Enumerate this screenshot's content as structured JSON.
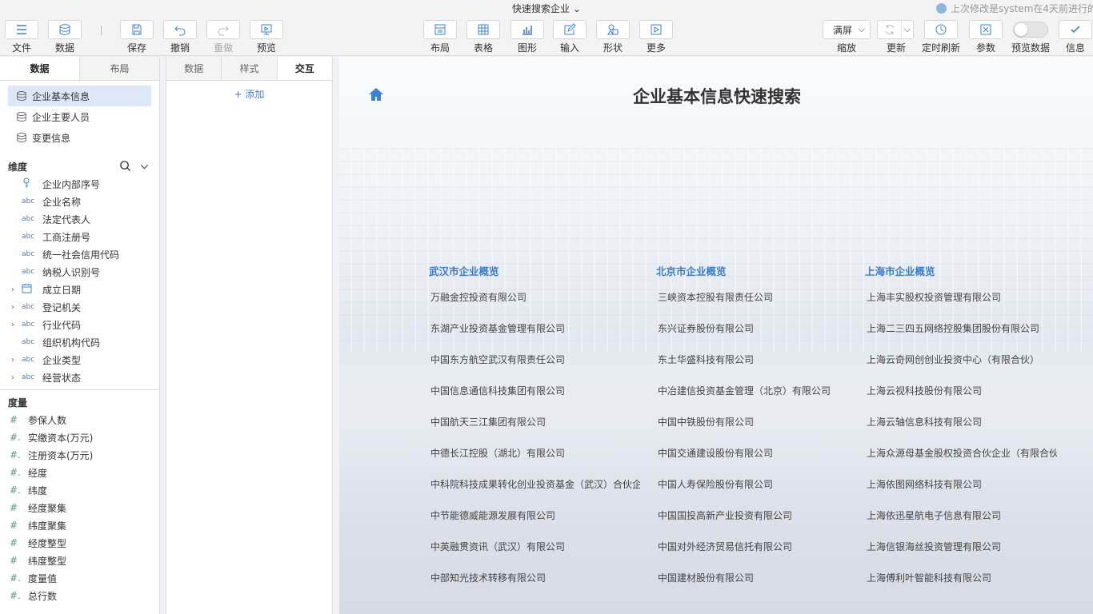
{
  "window": {
    "doc_title": "快速搜索企业",
    "last_modified": "上次修改是system在4天前进行的"
  },
  "toolbar": {
    "file": "文件",
    "data": "数据",
    "save": "保存",
    "undo": "撤销",
    "redo": "重做",
    "preview": "预览",
    "layout": "布局",
    "table": "表格",
    "chart": "图形",
    "input": "输入",
    "shape": "形状",
    "more": "更多",
    "zoom_value": "满屏",
    "zoom": "缩放",
    "refresh": "更新",
    "timed_refresh": "定时刷新",
    "params": "参数",
    "preview_data": "预览数据",
    "info": "信息"
  },
  "left_panel": {
    "tabs": [
      "数据",
      "布局"
    ],
    "datasets": [
      "企业基本信息",
      "企业主要人员",
      "变更信息"
    ],
    "dimensions_title": "维度",
    "dimensions": [
      {
        "label": "企业内部序号",
        "type": "key",
        "expandable": false
      },
      {
        "label": "企业名称",
        "type": "abc",
        "expandable": false
      },
      {
        "label": "法定代表人",
        "type": "abc",
        "expandable": false
      },
      {
        "label": "工商注册号",
        "type": "abc",
        "expandable": false
      },
      {
        "label": "统一社会信用代码",
        "type": "abc",
        "expandable": false
      },
      {
        "label": "纳税人识别号",
        "type": "abc",
        "expandable": false
      },
      {
        "label": "成立日期",
        "type": "date",
        "expandable": true
      },
      {
        "label": "登记机关",
        "type": "abc",
        "expandable": true
      },
      {
        "label": "行业代码",
        "type": "abc",
        "expandable": true
      },
      {
        "label": "组织机构代码",
        "type": "abc",
        "expandable": false
      },
      {
        "label": "企业类型",
        "type": "abc",
        "expandable": true
      },
      {
        "label": "经营状态",
        "type": "abc",
        "expandable": true
      }
    ],
    "measures_title": "度量",
    "measures": [
      {
        "label": "参保人数",
        "symbol": "#"
      },
      {
        "label": "实缴资本(万元)",
        "symbol": "#."
      },
      {
        "label": "注册资本(万元)",
        "symbol": "#."
      },
      {
        "label": "经度",
        "symbol": "#."
      },
      {
        "label": "纬度",
        "symbol": "#."
      },
      {
        "label": "经度聚集",
        "symbol": "#"
      },
      {
        "label": "纬度聚集",
        "symbol": "#"
      },
      {
        "label": "经度整型",
        "symbol": "#"
      },
      {
        "label": "纬度整型",
        "symbol": "#"
      },
      {
        "label": "度量值",
        "symbol": "#."
      },
      {
        "label": "总行数",
        "symbol": "#."
      }
    ]
  },
  "mid_panel": {
    "tabs": [
      "数据",
      "样式",
      "交互"
    ],
    "add": "+ 添加"
  },
  "canvas": {
    "title": "企业基本信息快速搜索",
    "columns": [
      {
        "title": "武汉市企业概览",
        "items": [
          "万融金控投资有限公司",
          "东湖产业投资基金管理有限公司",
          "中国东方航空武汉有限责任公司",
          "中国信息通信科技集团有限公司",
          "中国航天三江集团有限公司",
          "中德长江控股（湖北）有限公司",
          "中科院科技成果转化创业投资基金（武汉）合伙企",
          "中节能德威能源发展有限公司",
          "中英融贯资讯（武汉）有限公司",
          "中部知光技术转移有限公司"
        ]
      },
      {
        "title": "北京市企业概览",
        "items": [
          "三峡资本控股有限责任公司",
          "东兴证券股份有限公司",
          "东土华盛科技有限公司",
          "中冶建信投资基金管理（北京）有限公司",
          "中国中铁股份有限公司",
          "中国交通建设股份有限公司",
          "中国人寿保险股份有限公司",
          "中国国投高新产业投资有限公司",
          "中国对外经济贸易信托有限公司",
          "中国建材股份有限公司"
        ]
      },
      {
        "title": "上海市企业概览",
        "items": [
          "上海丰实股权投资管理有限公司",
          "上海二三四五网络控股集团股份有限公司",
          "上海云奇网创创业投资中心（有限合伙）",
          "上海云视科技股份有限公司",
          "上海云轴信息科技有限公司",
          "上海众源母基金股权投资合伙企业（有限合伙",
          "上海依图网络科技有限公司",
          "上海依迅星航电子信息有限公司",
          "上海信银海丝投资管理有限公司",
          "上海傅利叶智能科技有限公司"
        ]
      }
    ]
  }
}
